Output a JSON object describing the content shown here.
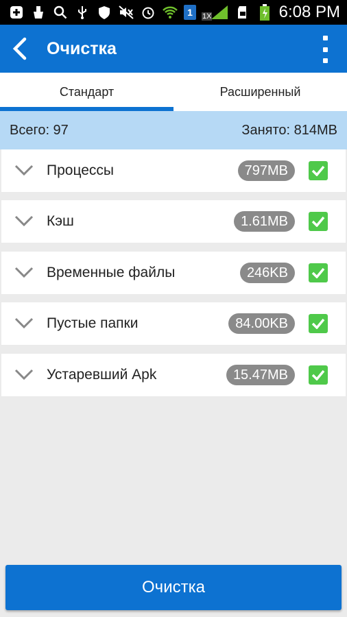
{
  "status_bar": {
    "time": "6:08 PM",
    "icons": [
      "add-notification-icon",
      "cleaner-icon",
      "search-icon",
      "usb-icon",
      "shield-icon",
      "mute-icon",
      "alarm-icon",
      "wifi-icon",
      "sim-1-icon",
      "signal-icon",
      "sd-card-icon",
      "battery-charging-icon"
    ],
    "sim_label": "1",
    "network_label": "1X"
  },
  "app_bar": {
    "title": "Очистка"
  },
  "tabs": [
    {
      "label": "Стандарт",
      "active": true
    },
    {
      "label": "Расширенный",
      "active": false
    }
  ],
  "summary": {
    "total": "Всего: 97",
    "used": "Занято: 814MB"
  },
  "items": [
    {
      "label": "Процессы",
      "size": "797MB",
      "checked": true
    },
    {
      "label": "Кэш",
      "size": "1.61MB",
      "checked": true
    },
    {
      "label": "Временные файлы",
      "size": "246KB",
      "checked": true
    },
    {
      "label": "Пустые папки",
      "size": "84.00KB",
      "checked": true
    },
    {
      "label": "Устаревший Apk",
      "size": "15.47MB",
      "checked": true
    }
  ],
  "action_button": {
    "label": "Очистка"
  },
  "colors": {
    "primary": "#0d72d1",
    "summary_bg": "#b6d9f5",
    "badge": "#8a8a8a",
    "check": "#4fc94a"
  }
}
